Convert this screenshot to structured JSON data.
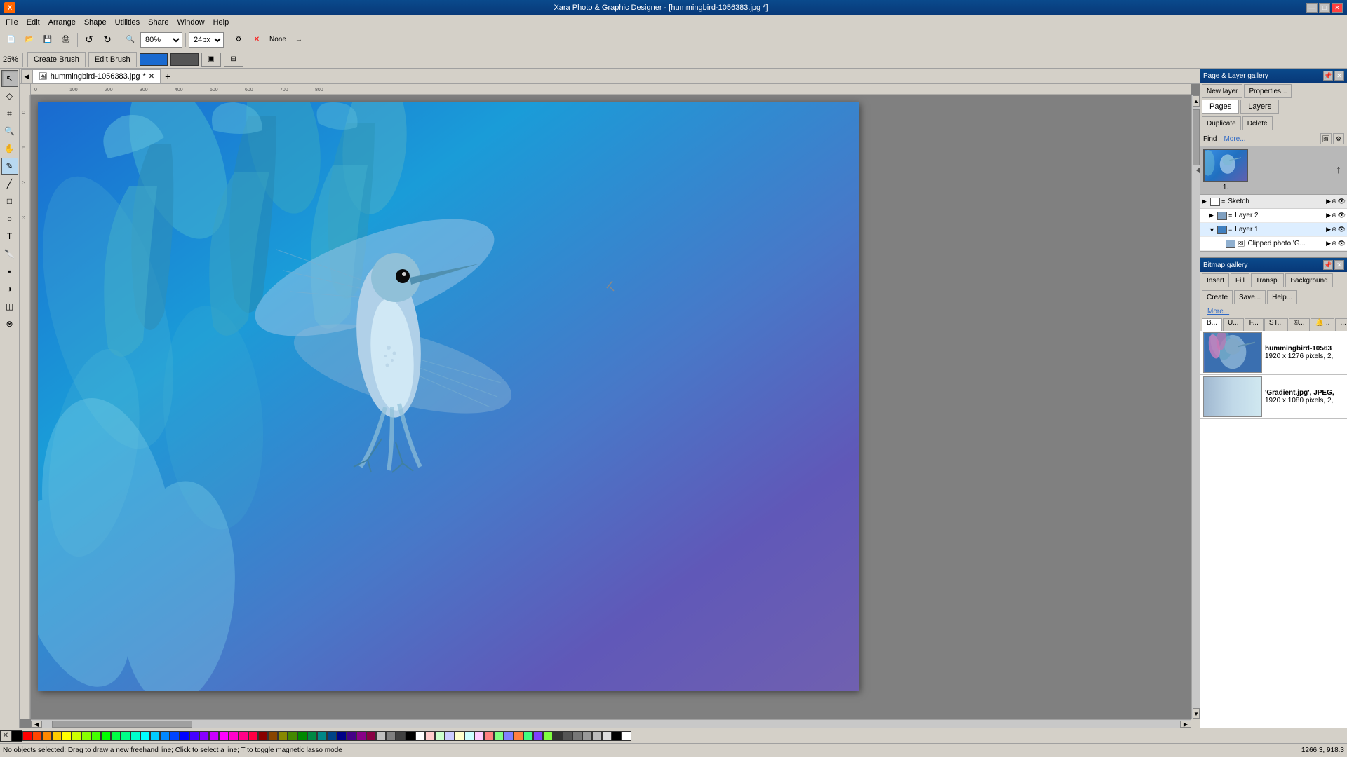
{
  "app": {
    "title": "Xara Photo & Graphic Designer - [hummingbird-1056383.jpg *]",
    "icon": "xara-icon"
  },
  "titlebar": {
    "title": "Xara Photo & Graphic Designer - [hummingbird-1056383.jpg *]",
    "min_label": "—",
    "max_label": "□",
    "close_label": "✕"
  },
  "menubar": {
    "items": [
      "File",
      "Edit",
      "Arrange",
      "Shape",
      "Utilities",
      "Share",
      "Window",
      "Help"
    ]
  },
  "toolbar": {
    "zoom_value": "80%",
    "size_value": "24px",
    "buttons": [
      "new",
      "open",
      "save",
      "print",
      "undo",
      "redo",
      "zoom_in",
      "zoom_out"
    ]
  },
  "context_toolbar": {
    "zoom_label": "25%",
    "create_brush_label": "Create Brush",
    "edit_brush_label": "Edit Brush"
  },
  "canvas": {
    "zoom": "25%",
    "tab_name": "hummingbird-1056383.jpg",
    "tab_modified": true
  },
  "page_layer_gallery": {
    "title": "Page & Layer gallery",
    "buttons": {
      "new_layer": "New layer",
      "properties": "Properties...",
      "duplicate": "Duplicate",
      "delete": "Delete",
      "find": "Find",
      "more": "More..."
    },
    "tabs": {
      "pages": "Pages",
      "layers": "Layers"
    },
    "pages": [
      {
        "id": "1",
        "label": "1."
      }
    ],
    "layers": [
      {
        "name": "Sketch",
        "level": 0,
        "type": "group",
        "expanded": false
      },
      {
        "name": "Layer 2",
        "level": 1,
        "type": "layer",
        "expanded": false
      },
      {
        "name": "Layer 1",
        "level": 1,
        "type": "layer",
        "expanded": true
      },
      {
        "name": "Clipped photo 'G...",
        "level": 2,
        "type": "photo",
        "expanded": false
      }
    ]
  },
  "bitmap_gallery": {
    "title": "Bitmap gallery",
    "buttons": {
      "insert": "Insert",
      "fill": "Fill",
      "transp": "Transp.",
      "background": "Background",
      "create": "Create",
      "save": "Save...",
      "help": "Help...",
      "more": "More..."
    },
    "tabs": [
      "B...",
      "U...",
      "F...",
      "ST...",
      "©...",
      "🔔...",
      "..."
    ],
    "items": [
      {
        "name": "hummingbird-10563",
        "info": "1920 x 1276 pixels, 2,",
        "bg_color": "#2a7fd4"
      },
      {
        "name": "'Gradient.jpg',  JPEG,",
        "info": "1920 x 1080 pixels, 2,",
        "bg_color": "#a0b8d0"
      }
    ]
  },
  "status_bar": {
    "left": "No objects selected: Drag to draw a new freehand line; Click to select a line;  T to toggle magnetic lasso mode",
    "right": "1266.3, 918.3"
  },
  "palette": {
    "colors": [
      "#000000",
      "#ffffff",
      "#ff0000",
      "#00ff00",
      "#0000ff",
      "#ffff00",
      "#ff8800",
      "#8800ff",
      "#00ffff",
      "#ff00ff",
      "#800000",
      "#008000",
      "#000080",
      "#808000",
      "#008080",
      "#800080",
      "#c0c0c0",
      "#808080",
      "#ff8080",
      "#80ff80",
      "#8080ff",
      "#ffff80",
      "#ff80ff",
      "#80ffff",
      "#ff4400",
      "#44ff00",
      "#0044ff",
      "#ff0044",
      "#44ffff",
      "#ffaa00",
      "#aa00ff",
      "#00ffaa",
      "#ff6666",
      "#66ff66",
      "#6666ff",
      "#ffaa66",
      "#aa66ff",
      "#66ffaa",
      "#334455",
      "#557733"
    ]
  }
}
